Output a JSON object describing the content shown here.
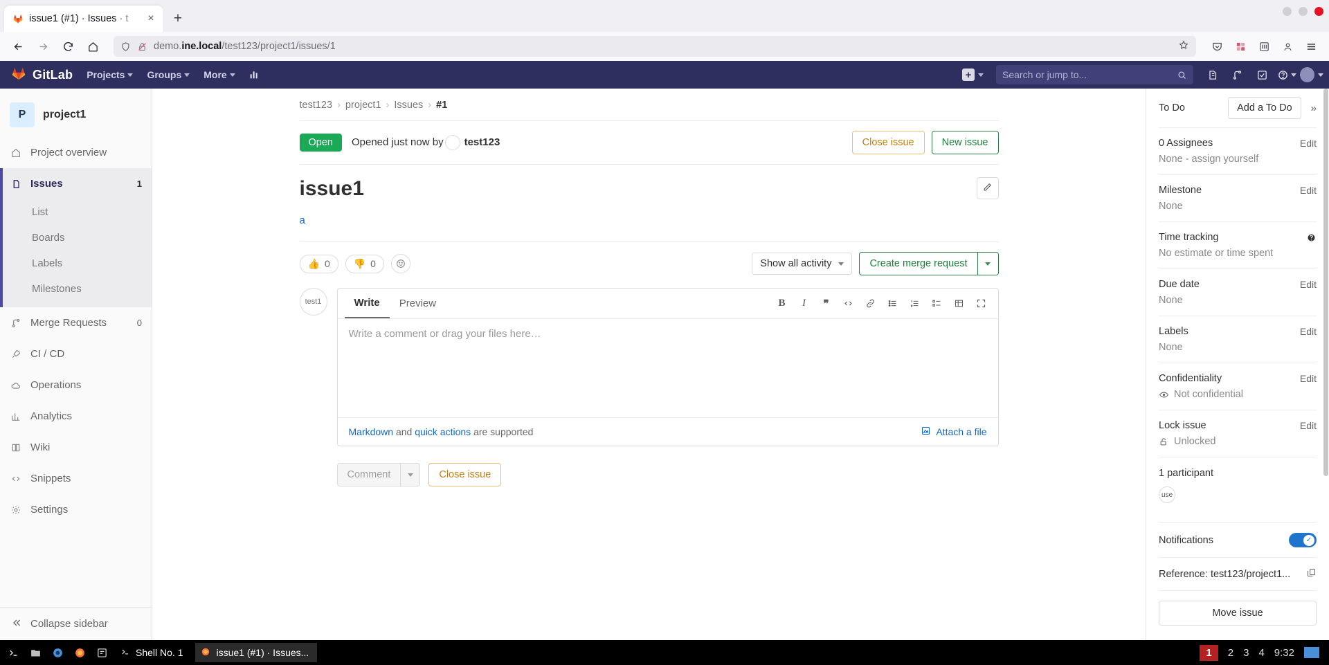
{
  "browser": {
    "tab": {
      "title": "issue1 (#1) · Issues · t",
      "favicon": "gitlab-favicon",
      "close": "×"
    },
    "new_tab": "+",
    "url": {
      "prefix": "demo.",
      "bold": "ine.local",
      "suffix": "/test123/project1/issues/1"
    },
    "icons": {
      "back": "back-icon",
      "forward": "forward-icon",
      "reload": "reload-icon",
      "home": "home-icon",
      "shield": "shield-icon",
      "permissions": "permissions-icon",
      "bookmark": "star-icon",
      "save_to_pocket": "pocket-icon",
      "extension": "extension-icon",
      "account": "account-icon",
      "menu": "hamburger-menu-icon"
    }
  },
  "gitlab_nav": {
    "brand": "GitLab",
    "items": [
      {
        "label": "Projects"
      },
      {
        "label": "Groups"
      },
      {
        "label": "More"
      }
    ],
    "analytics_icon": "chart-bar-icon",
    "plus_label": "+",
    "search_placeholder": "Search or jump to...",
    "right_icons": [
      "issues-icon",
      "merge-requests-icon",
      "todos-icon",
      "help-icon",
      "user-avatar"
    ]
  },
  "sidebar": {
    "project": {
      "initial": "P",
      "name": "project1"
    },
    "items": [
      {
        "label": "Project overview",
        "icon": "home-icon",
        "count": "",
        "active": false
      },
      {
        "label": "Issues",
        "icon": "issue-icon",
        "count": "1",
        "active": true
      },
      {
        "label": "Merge Requests",
        "icon": "merge-icon",
        "count": "0",
        "active": false
      },
      {
        "label": "CI / CD",
        "icon": "rocket-icon",
        "count": "",
        "active": false
      },
      {
        "label": "Operations",
        "icon": "cloud-icon",
        "count": "",
        "active": false
      },
      {
        "label": "Analytics",
        "icon": "analytics-icon",
        "count": "",
        "active": false
      },
      {
        "label": "Wiki",
        "icon": "book-icon",
        "count": "",
        "active": false
      },
      {
        "label": "Snippets",
        "icon": "snippet-icon",
        "count": "",
        "active": false
      },
      {
        "label": "Settings",
        "icon": "gear-icon",
        "count": "",
        "active": false
      }
    ],
    "sub_items": [
      {
        "label": "List"
      },
      {
        "label": "Boards"
      },
      {
        "label": "Labels"
      },
      {
        "label": "Milestones"
      }
    ],
    "collapse": "Collapse sidebar"
  },
  "breadcrumb": {
    "group": "test123",
    "project": "project1",
    "section": "Issues",
    "current": "#1"
  },
  "issue": {
    "state_badge": "Open",
    "opened_text": "Opened just now by",
    "author": "test123",
    "close_button": "Close issue",
    "new_button": "New issue",
    "title": "issue1",
    "edit_icon": "pencil-icon",
    "description": "a",
    "reactions": [
      {
        "emoji": "thumbs-up",
        "glyph": "👍",
        "count": "0"
      },
      {
        "emoji": "thumbs-down",
        "glyph": "👎",
        "count": "0"
      }
    ],
    "add_reaction_icon": "emoji-smile-icon",
    "activity_filter": "Show all activity",
    "create_mr": "Create merge request"
  },
  "comment_form": {
    "tabs": [
      {
        "label": "Write",
        "active": true
      },
      {
        "label": "Preview",
        "active": false
      }
    ],
    "toolbar": [
      {
        "name": "bold-icon",
        "glyph": "B"
      },
      {
        "name": "italic-icon",
        "glyph": "I"
      },
      {
        "name": "quote-icon",
        "glyph": "❞"
      },
      {
        "name": "code-icon",
        "glyph": "‹›"
      },
      {
        "name": "link-icon",
        "glyph": "🔗"
      },
      {
        "name": "bulleted-list-icon",
        "glyph": "☰"
      },
      {
        "name": "numbered-list-icon",
        "glyph": "≡"
      },
      {
        "name": "task-list-icon",
        "glyph": "☑"
      },
      {
        "name": "table-icon",
        "glyph": "▦"
      },
      {
        "name": "fullscreen-icon",
        "glyph": "⤢"
      }
    ],
    "placeholder": "Write a comment or drag your files here…",
    "footer": {
      "markdown": "Markdown",
      "and": "and",
      "quick_actions": "quick actions",
      "supported": "are supported",
      "attach": "Attach a file"
    },
    "comment_button": "Comment",
    "close_issue_button": "Close issue",
    "avatar_text": "test1"
  },
  "right_sidebar": {
    "todo": {
      "label": "To Do",
      "button": "Add a To Do",
      "collapse_icon": "chevron-double-right-icon"
    },
    "rows": [
      {
        "label": "0 Assignees",
        "action": "Edit",
        "value": "None - assign yourself",
        "icon": ""
      },
      {
        "label": "Milestone",
        "action": "Edit",
        "value": "None",
        "icon": ""
      },
      {
        "label": "Time tracking",
        "action": "help-icon",
        "value": "No estimate or time spent",
        "icon": ""
      },
      {
        "label": "Due date",
        "action": "Edit",
        "value": "None",
        "icon": ""
      },
      {
        "label": "Labels",
        "action": "Edit",
        "value": "None",
        "icon": ""
      },
      {
        "label": "Confidentiality",
        "action": "Edit",
        "value": "Not confidential",
        "icon": "eye-icon"
      },
      {
        "label": "Lock issue",
        "action": "Edit",
        "value": "Unlocked",
        "icon": "unlock-icon"
      }
    ],
    "participants": {
      "label": "1 participant",
      "avatar_text": "use"
    },
    "notifications": {
      "label": "Notifications",
      "enabled": true
    },
    "reference": {
      "text": "Reference: test123/project1...",
      "copy_icon": "copy-icon"
    },
    "move_issue": "Move issue"
  },
  "taskbar": {
    "launchers": [
      "terminal-icon",
      "files-icon",
      "browser-icon",
      "firefox-icon",
      "editor-icon"
    ],
    "windows": [
      {
        "label": "Shell No. 1",
        "icon": "terminal-icon",
        "active": false
      },
      {
        "label": "issue1 (#1) · Issues...",
        "icon": "firefox-icon",
        "active": true
      }
    ],
    "workspaces": [
      "1",
      "2",
      "3",
      "4"
    ],
    "current_workspace": "1",
    "clock": "9:32"
  },
  "colors": {
    "gitlab_nav": "#2e2e5f",
    "open_badge": "#1aaa55",
    "link": "#1068bf",
    "warn_button": "#c17d10",
    "green_button": "#1a7f37",
    "toggle_on": "#1f75cb",
    "workspace_active": "#b32121"
  }
}
